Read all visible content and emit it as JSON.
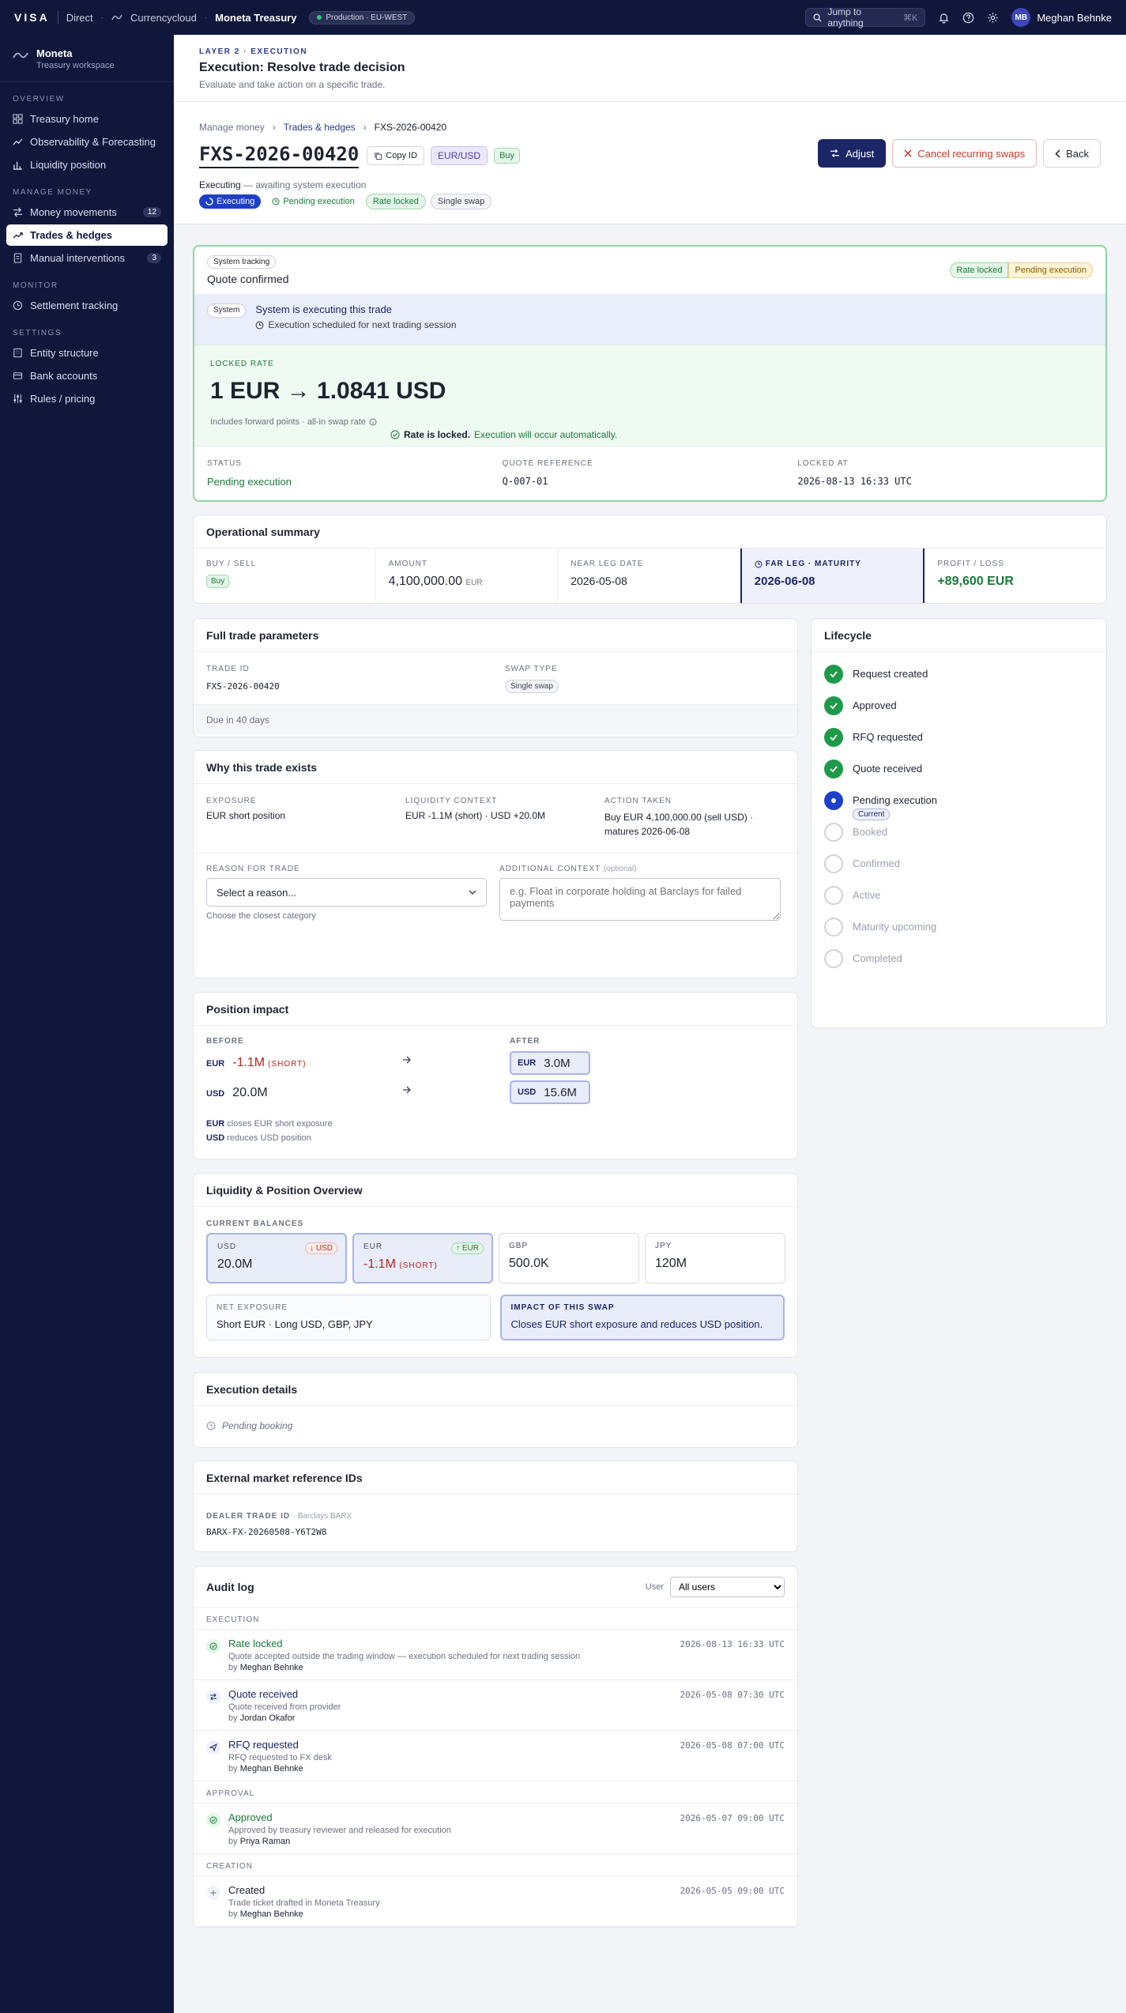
{
  "topbar": {
    "brand": "VISA",
    "direct": "Direct",
    "org": "Currencycloud",
    "app": "Moneta Treasury",
    "env": "Production · EU-WEST",
    "search_placeholder": "Jump to anything",
    "search_kbd": "⌘K",
    "avatar_initials": "MB",
    "user_name": "Meghan Behnke"
  },
  "sidebar": {
    "workspace_name": "Moneta",
    "workspace_sub": "Treasury workspace",
    "sections": [
      {
        "title": "OVERVIEW",
        "items": [
          {
            "label": "Treasury home",
            "icon": "grid-icon"
          },
          {
            "label": "Observability & Forecasting",
            "icon": "chart-icon"
          },
          {
            "label": "Liquidity position",
            "icon": "bar-chart-icon"
          }
        ]
      },
      {
        "title": "MANAGE MONEY",
        "items": [
          {
            "label": "Money movements",
            "icon": "arrows-icon",
            "count": "12"
          },
          {
            "label": "Trades & hedges",
            "icon": "trend-icon",
            "active": true
          },
          {
            "label": "Manual interventions",
            "icon": "doc-icon",
            "count": "3"
          }
        ]
      },
      {
        "title": "MONITOR",
        "items": [
          {
            "label": "Settlement tracking",
            "icon": "clock-icon"
          }
        ]
      },
      {
        "title": "SETTINGS",
        "items": [
          {
            "label": "Entity structure",
            "icon": "building-icon"
          },
          {
            "label": "Bank accounts",
            "icon": "bank-icon"
          },
          {
            "label": "Rules / pricing",
            "icon": "sliders-icon"
          }
        ]
      }
    ]
  },
  "header": {
    "layer": "LAYER 2 · EXECUTION",
    "title": "Execution: Resolve trade decision",
    "subtitle": "Evaluate and take action on a specific trade."
  },
  "breadcrumb": [
    "Manage money",
    "Trades & hedges",
    "FXS-2026-00420"
  ],
  "trade": {
    "id": "FXS-2026-00420",
    "copy_label": "Copy ID",
    "pair": "EUR/USD",
    "side": "Buy",
    "status_word": "Executing",
    "status_rest": " — awaiting system execution",
    "chips": [
      "Executing",
      "Pending execution",
      "Rate locked",
      "Single swap"
    ],
    "actions": {
      "adjust": "Adjust",
      "cancel": "Cancel recurring swaps",
      "back": "Back"
    }
  },
  "quote": {
    "tag": "System tracking",
    "title": "Quote confirmed",
    "tags": [
      "Rate locked",
      "Pending execution"
    ],
    "sys_tag": "System",
    "sys_title": "System is executing this trade",
    "sys_sub": "Execution scheduled for next trading session",
    "rate_label": "LOCKED RATE",
    "rate": "1 EUR → 1.0841 USD",
    "rate_note": "Includes forward points · all-in swap rate",
    "lock_bold": "Rate is locked.",
    "lock_rest": " Execution will occur automatically.",
    "status_label": "STATUS",
    "status_value": "Pending execution",
    "ref_label": "QUOTE REFERENCE",
    "ref_value": "Q-007-01",
    "locked_label": "LOCKED AT",
    "locked_value": "2026-08-13 16:33 UTC"
  },
  "ops": {
    "title": "Operational summary",
    "buy_label": "BUY / SELL",
    "buy_value": "Buy",
    "amount_label": "AMOUNT",
    "amount_value": "4,100,000.00",
    "amount_ccy": "EUR",
    "near_label": "NEAR LEG DATE",
    "near_value": "2026-05-08",
    "far_label": "FAR LEG · MATURITY",
    "far_value": "2026-06-08",
    "pnl_label": "PROFIT / LOSS",
    "pnl_value": "+89,600 EUR"
  },
  "params": {
    "title": "Full trade parameters",
    "trade_id_label": "TRADE ID",
    "trade_id": "FXS-2026-00420",
    "swap_label": "SWAP TYPE",
    "swap_value": "Single swap",
    "due": "Due in 40 days"
  },
  "why": {
    "title": "Why this trade exists",
    "exposure_label": "EXPOSURE",
    "exposure": "EUR short position",
    "liq_label": "LIQUIDITY CONTEXT",
    "liq": "EUR -1.1M (short) · USD +20.0M",
    "action_label": "ACTION TAKEN",
    "action": "Buy EUR 4,100,000.00 (sell USD) · matures 2026-06-08",
    "reason_label": "REASON FOR TRADE",
    "reason_placeholder": "Select a reason...",
    "reason_hint": "Choose the closest category",
    "ctx_label": "ADDITIONAL CONTEXT",
    "ctx_optional": "(optional)",
    "ctx_placeholder": "e.g. Float in corporate holding at Barclays for failed payments"
  },
  "impact": {
    "title": "Position impact",
    "before_label": "BEFORE",
    "after_label": "AFTER",
    "eur_ccy": "EUR",
    "eur_before": "-1.1M",
    "eur_short": "(SHORT)",
    "eur_after": "3.0M",
    "usd_ccy": "USD",
    "usd_before": "20.0M",
    "usd_after": "15.6M",
    "note1": "closes EUR short exposure",
    "note2": "reduces USD position"
  },
  "liquidity": {
    "title": "Liquidity & Position Overview",
    "balances_label": "CURRENT BALANCES",
    "balances": [
      {
        "ccy": "USD",
        "amount": "20.0M",
        "badge": "↓ USD"
      },
      {
        "ccy": "EUR",
        "amount": "-1.1M",
        "suffix": "(SHORT)",
        "badge": "↑ EUR"
      },
      {
        "ccy": "GBP",
        "amount": "500.0K"
      },
      {
        "ccy": "JPY",
        "amount": "120M"
      }
    ],
    "net_label": "NET EXPOSURE",
    "net_value": "Short EUR · Long USD, GBP, JPY",
    "impact_label": "IMPACT OF THIS SWAP",
    "impact_value": "Closes EUR short exposure and reduces USD position."
  },
  "execution": {
    "title": "Execution details",
    "pending": "Pending booking"
  },
  "external": {
    "title": "External market reference IDs",
    "dealer_label": "DEALER TRADE ID",
    "dealer_bank": "· Barclays BARX",
    "dealer_value": "BARX-FX-20260508-Y6T2W8"
  },
  "lifecycle": {
    "title": "Lifecycle",
    "current_tag": "Current",
    "steps": [
      {
        "label": "Request created",
        "state": "done"
      },
      {
        "label": "Approved",
        "state": "done"
      },
      {
        "label": "RFQ requested",
        "state": "done"
      },
      {
        "label": "Quote received",
        "state": "done"
      },
      {
        "label": "Pending execution",
        "state": "current"
      },
      {
        "label": "Booked",
        "state": "todo"
      },
      {
        "label": "Confirmed",
        "state": "todo"
      },
      {
        "label": "Active",
        "state": "todo"
      },
      {
        "label": "Maturity upcoming",
        "state": "todo"
      },
      {
        "label": "Completed",
        "state": "todo"
      }
    ]
  },
  "audit": {
    "title": "Audit log",
    "user_label": "User",
    "user_filter": "All users",
    "by": "by",
    "groups": [
      {
        "name": "EXECUTION",
        "rows": [
          {
            "title": "Rate locked",
            "desc": "Quote accepted outside the trading window — execution scheduled for next trading session",
            "user": "Meghan Behnke",
            "time": "2026-08-13 16:33 UTC",
            "kind": "check"
          },
          {
            "title": "Quote received",
            "desc": "Quote received from provider",
            "user": "Jordan Okafor",
            "time": "2026-05-08 07:30 UTC",
            "kind": "swap"
          },
          {
            "title": "RFQ requested",
            "desc": "RFQ requested to FX desk",
            "user": "Meghan Behnke",
            "time": "2026-05-08 07:00 UTC",
            "kind": "send"
          }
        ]
      },
      {
        "name": "APPROVAL",
        "rows": [
          {
            "title": "Approved",
            "desc": "Approved by treasury reviewer and released for execution",
            "user": "Priya Raman",
            "time": "2026-05-07 09:00 UTC",
            "kind": "check"
          }
        ]
      },
      {
        "name": "CREATION",
        "rows": [
          {
            "title": "Created",
            "desc": "Trade ticket drafted in Moneta Treasury",
            "user": "Meghan Behnke",
            "time": "2026-05-05 09:00 UTC",
            "kind": "plus"
          }
        ]
      }
    ]
  },
  "colors": {
    "navy": "#10173b",
    "accent": "#1c2666",
    "success": "#1a7a3c",
    "danger": "#b3261e",
    "pending": "#8a5a00"
  }
}
